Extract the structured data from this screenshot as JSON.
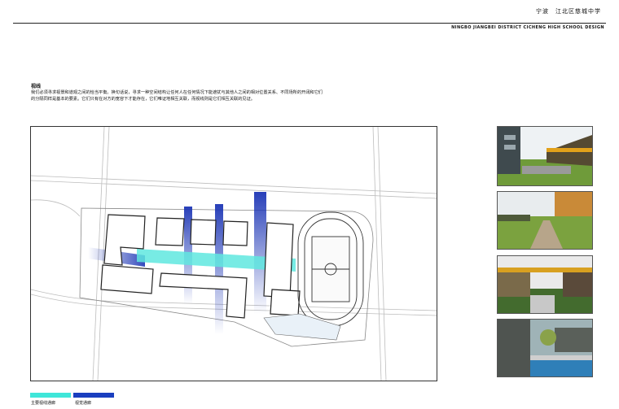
{
  "header": {
    "title_cn": "宁波　江北区慈城中学",
    "title_en": "NINGBO JIANGBEI DISTRICT CICHENG HIGH SCHOOL DESIGN"
  },
  "section": {
    "title": "视线",
    "text": "我们必须寻求视景和道观之间的恰当平衡。换句话说，寻求一种空间结构让任何人在任何情况下能遮扰与其他人之间的相对位置关系、不同场所的开阔和它们的分隔同样是基本的要素。它们只有在对方的宽容下才能存在，它们唯证地相互关联，而视线则是它们相互关联的见证。"
  },
  "legend": {
    "items": [
      {
        "label": "主要视线通廊",
        "color": "#3fe6d9"
      },
      {
        "label": "视觉通廊",
        "color": "#1a3fbf"
      }
    ]
  },
  "colors": {
    "corridor_cyan": "#5fe8df",
    "corridor_blue": "#1c35b5",
    "line": "#333333"
  },
  "thumbnails": [
    {
      "name": "perspective-courtyard"
    },
    {
      "name": "perspective-lawn-path"
    },
    {
      "name": "perspective-bridge"
    },
    {
      "name": "perspective-pool-trees"
    }
  ]
}
